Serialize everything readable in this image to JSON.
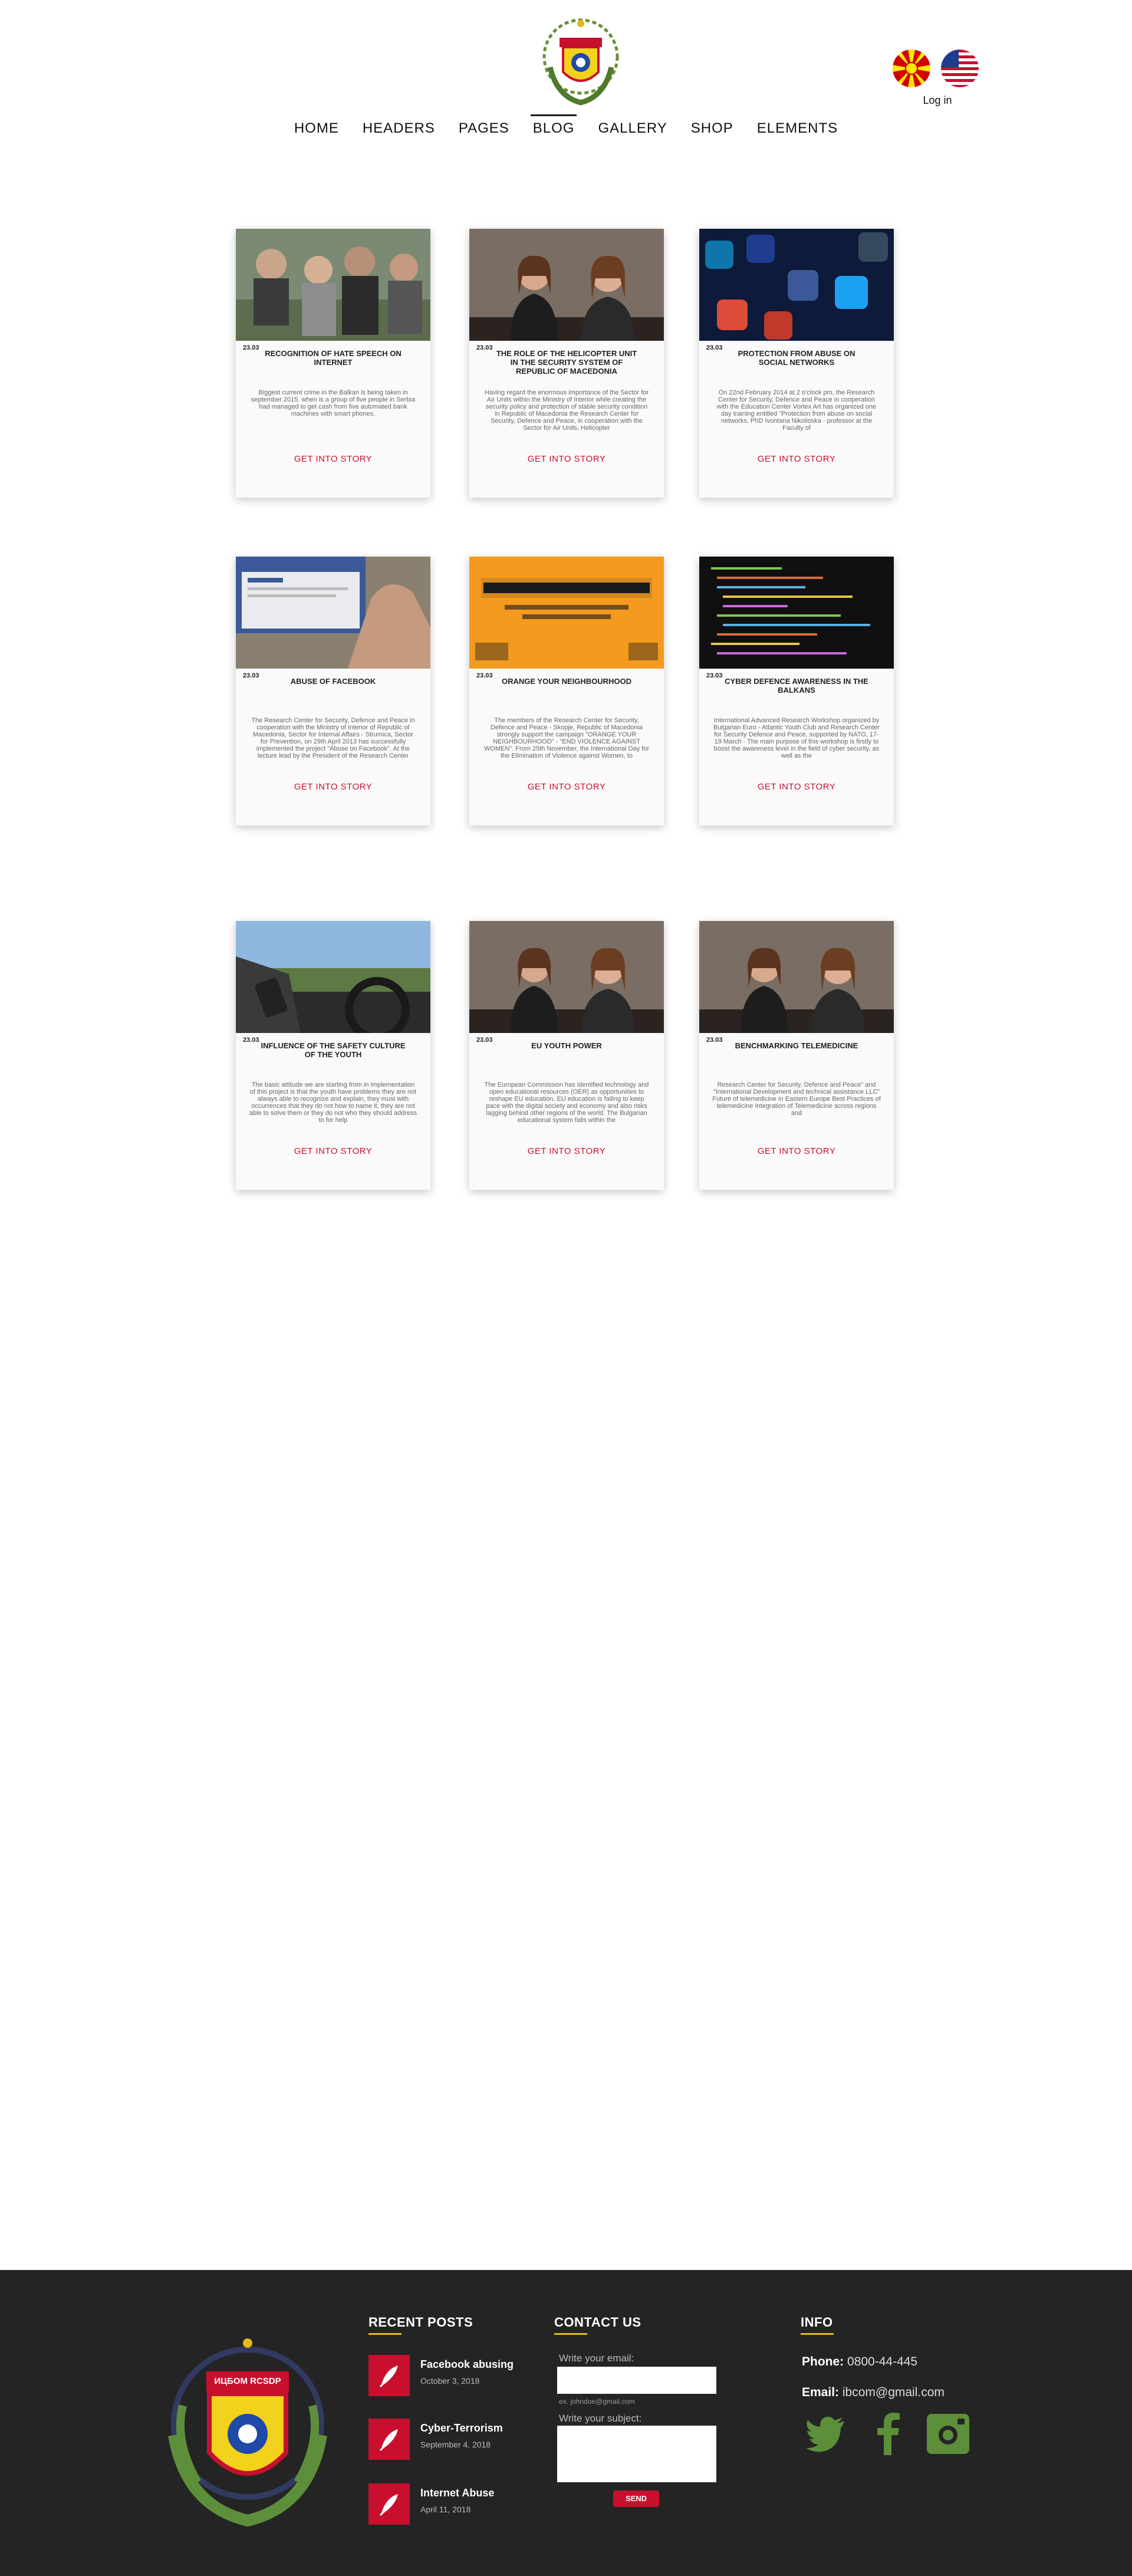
{
  "header": {
    "nav": [
      {
        "label": "HOME"
      },
      {
        "label": "HEADERS"
      },
      {
        "label": "PAGES"
      },
      {
        "label": "BLOG",
        "active": true
      },
      {
        "label": "GALLERY"
      },
      {
        "label": "SHOP"
      },
      {
        "label": "ELEMENTS"
      }
    ],
    "login": "Log in"
  },
  "cards": [
    {
      "date": "23.03",
      "title": "RECOGNITION OF HATE SPEECH ON INTERNET",
      "body": "Biggest current crime in the Balkan is being taken in september 2015. when is a group of five people in Serbia had managed to get cash from five automated bank machines with smart phones.",
      "link": "GET INTO STORY",
      "image": "crowd-photo"
    },
    {
      "date": "23.03",
      "title": "THE ROLE OF THE HELICOPTER UNIT IN THE SECURITY SYSTEM OF REPUBLIC OF MACEDONIA",
      "body": "Having regard the enormous importance of the Sector for Air Units within the Ministry of Interior while creating the security policy and protection of stable security condition in Republic of Macedonia the Research Center for Security, Defence and Peace, in cooperation with the Sector for Air Units, Helicopter",
      "link": "GET INTO STORY",
      "image": "two-women-photo"
    },
    {
      "date": "23.03",
      "title": "PROTECTION FROM ABUSE ON SOCIAL NETWORKS",
      "body": "On 22nd February 2014 at 2 o'clock pm, the Research Center for Security, Defence and Peace in cooperation with the Education Center Vortex Art has organized one day training entitled \"Protection from abuse on social networks. PhD Ivontana Nikolioska - professor at the Faculty of",
      "link": "GET INTO STORY",
      "image": "social-apps-photo"
    },
    {
      "date": "23.03",
      "title": "ABUSE OF FACEBOOK",
      "body": "The Research Center for Security, Defence and Peace in cooperation with the Ministry of Interior of Republic of Macedonia, Sector for Internal Affairs - Strumica, Sector for Prevention, on 29th April 2013 has successfully implemented the project \"Abuse on Facebook\". At the lecture lead by the President of the Research Center",
      "link": "GET INTO STORY",
      "image": "facebook-photo"
    },
    {
      "date": "23.03",
      "title": "ORANGE YOUR NEIGHBOURHOOD",
      "body": "The members of the Research Center for Security, Defence and Peace - Skopje, Republic of Macedonia strongly support the campaign \"ORANGE YOUR NEIGHBOURHOOD\" - \"END VIOLENCE AGAINST WOMEN\". From 25th November, the International Day for the Elimination of Violence against Women, to",
      "link": "GET INTO STORY",
      "image": "orange-poster"
    },
    {
      "date": "23.03",
      "title": "CYBER DEFENCE AWARENESS IN THE BALKANS",
      "body": "International Advanced Research Workshop organized by Bulgarian Euro - Atlantic Youth Club and Research Center for Security Defence and Peace, supported by NATO, 17-19 March - The main purpose of this workshop is firstly to boost the awareness level in the field of cyber security, as well as the",
      "link": "GET INTO STORY",
      "image": "code-photo"
    },
    {
      "date": "23.03",
      "title": "INFLUENCE OF THE SAFETY CULTURE OF THE YOUTH",
      "body": "The basic attitude we are starting from in implementation of this project is that the youth have problems they are not always able to recognize and explain, they must with occurrences that they do not how to name it, they are not able to solve them or they do not who they should address to for help",
      "link": "GET INTO STORY",
      "image": "driving-photo"
    },
    {
      "date": "23.03",
      "title": "EU YOUTH POWER",
      "body": "The European Commission has identified technology and open educational resources (OER) as opportunities to reshape EU education. EU education is failing to keep pace with the digital society and economy and also risks lagging behind other regions of the world. The Bulgarian educational system falls within the",
      "link": "GET INTO STORY",
      "image": "two-women-photo"
    },
    {
      "date": "23.03",
      "title": "BENCHMARKING TELEMEDICINE",
      "body": "Research Center for Security, Defence and Peace\" and \"International Development and technical assistance LLC\" Future of telemedicine in Eastern Europe Best Practices of telemedicine Integration of Telemedicine across regions and",
      "link": "GET INTO STORY",
      "image": "two-women-photo"
    }
  ],
  "footer": {
    "logo_text": "ИЦБОМ RCSDP",
    "recent_posts_heading": "RECENT POSTS",
    "posts": [
      {
        "title": "Facebook abusing",
        "date": "October 3, 2018"
      },
      {
        "title": "Cyber-Terrorism",
        "date": "September 4, 2018"
      },
      {
        "title": "Internet Abuse",
        "date": "April 11, 2018"
      }
    ],
    "contact_heading": "CONTACT US",
    "email_label": "Write your email:",
    "email_hint": "ex. johndoe@gmail.com",
    "subject_label": "Write your subject:",
    "send_label": "SEND",
    "info_heading": "INFO",
    "phone_label": "Phone:",
    "phone_value": "0800-44-445",
    "email_info_label": "Email:",
    "email_info_value": "ibcom@gmail.com",
    "social_color": "#5d8f3b"
  }
}
